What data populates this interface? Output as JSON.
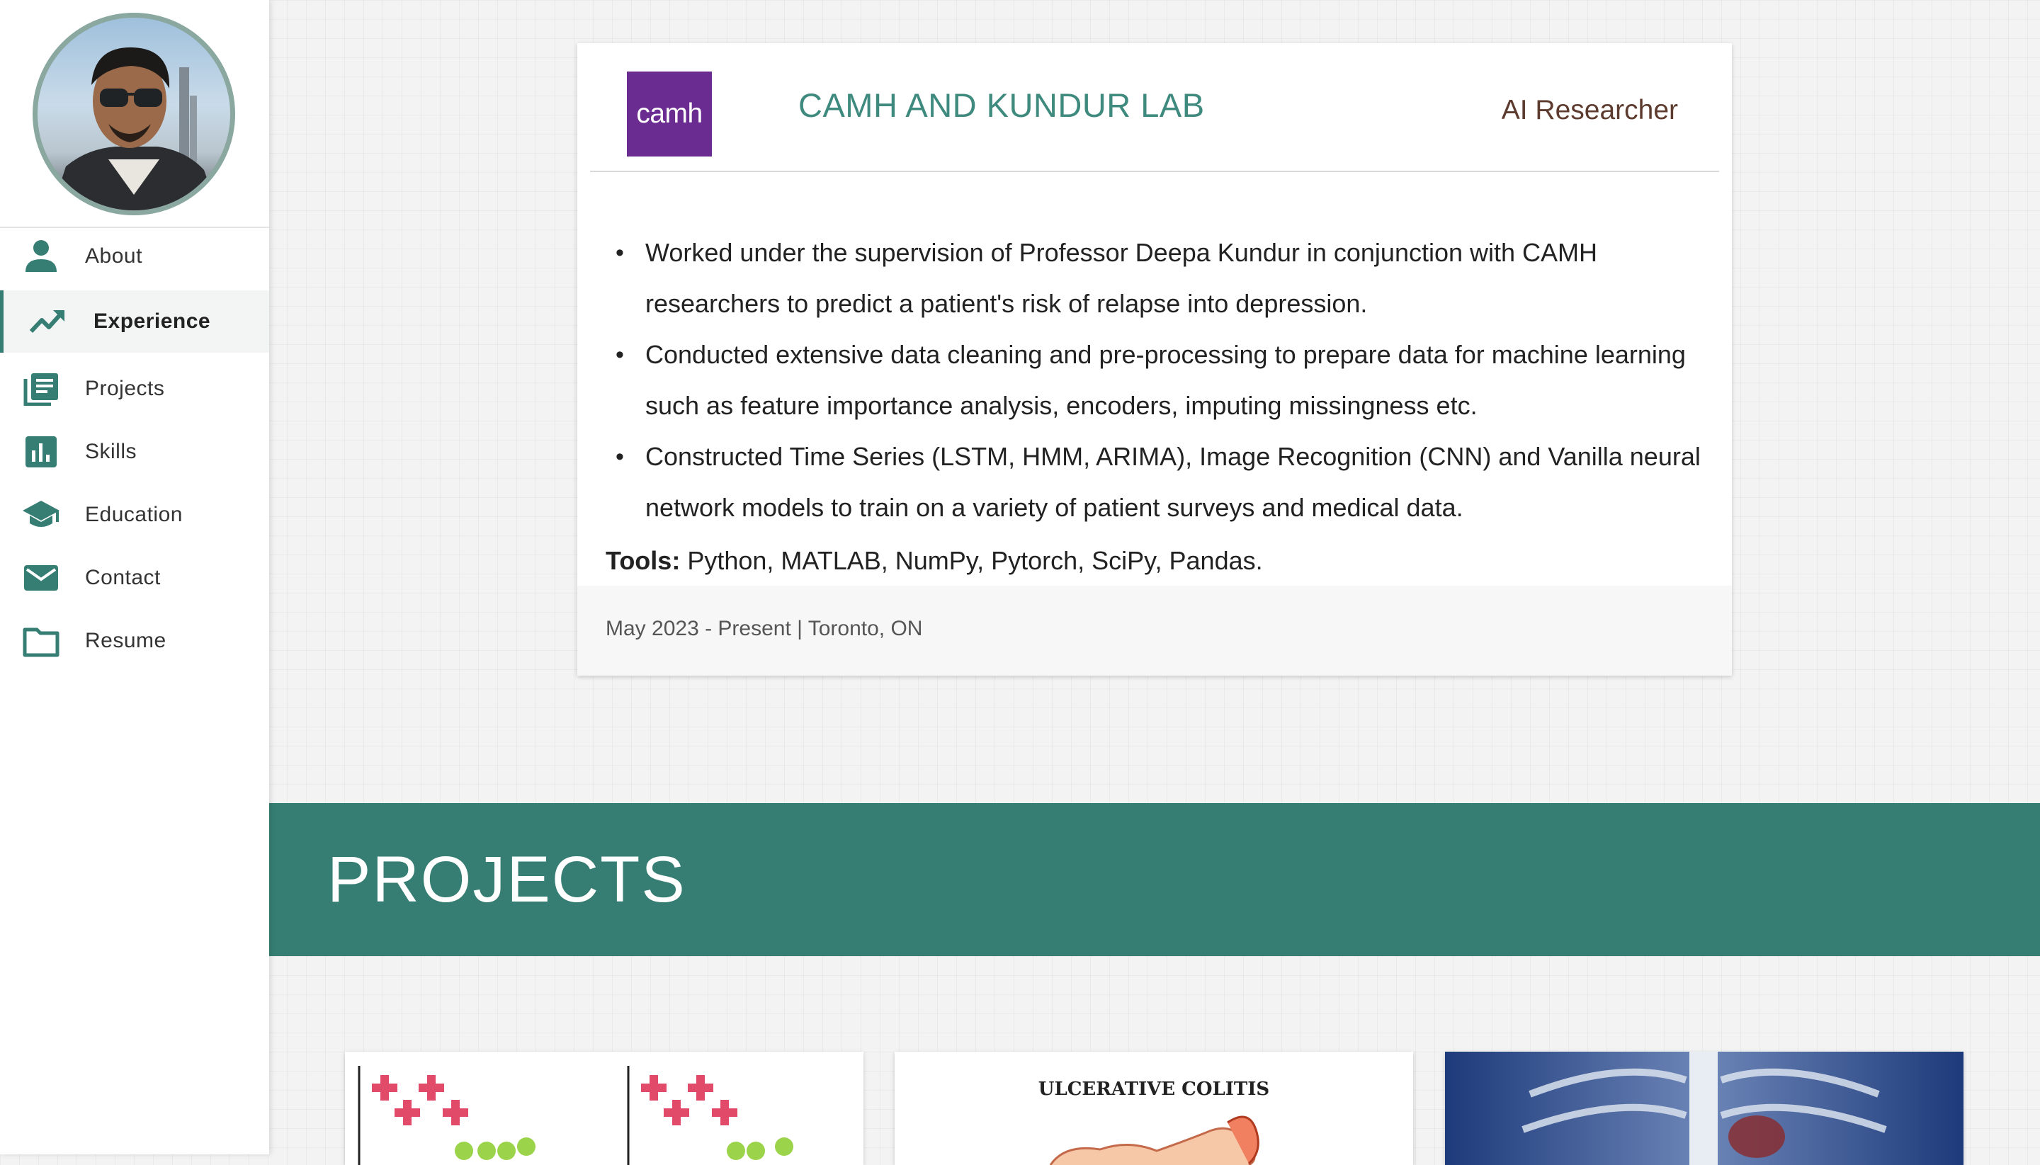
{
  "sidebar": {
    "items": [
      {
        "label": "About",
        "icon": "person-icon"
      },
      {
        "label": "Experience",
        "icon": "trending-up-icon",
        "active": true
      },
      {
        "label": "Projects",
        "icon": "library-books-icon"
      },
      {
        "label": "Skills",
        "icon": "bar-chart-icon"
      },
      {
        "label": "Education",
        "icon": "graduation-cap-icon"
      },
      {
        "label": "Contact",
        "icon": "mail-icon"
      },
      {
        "label": "Resume",
        "icon": "folder-icon"
      }
    ]
  },
  "experience": {
    "logo_text": "camh",
    "company": "CAMH AND KUNDUR LAB",
    "role": "AI Researcher",
    "bullets": [
      "Worked under the supervision of Professor Deepa Kundur in conjunction with CAMH researchers to predict a patient's risk of relapse into depression.",
      "Conducted extensive data cleaning and pre-processing to prepare data for machine learning such as feature importance analysis, encoders, imputing missingness etc.",
      "Constructed Time Series (LSTM, HMM, ARIMA), Image Recognition (CNN) and Vanilla neural network models to train on a variety of patient surveys and medical data."
    ],
    "tools_label": "Tools:",
    "tools_value": " Python, MATLAB, NumPy, Pytorch, SciPy, Pandas.",
    "footer": "May 2023 - Present | Toronto, ON"
  },
  "projects": {
    "title": "PROJECTS",
    "cards": [
      {
        "caption": ""
      },
      {
        "caption": "ULCERATIVE COLITIS"
      },
      {
        "caption": ""
      }
    ]
  },
  "colors": {
    "accent": "#367e73",
    "company": "#3f8a7e",
    "logo_bg": "#6b2c91",
    "role": "#5d3b2e"
  }
}
